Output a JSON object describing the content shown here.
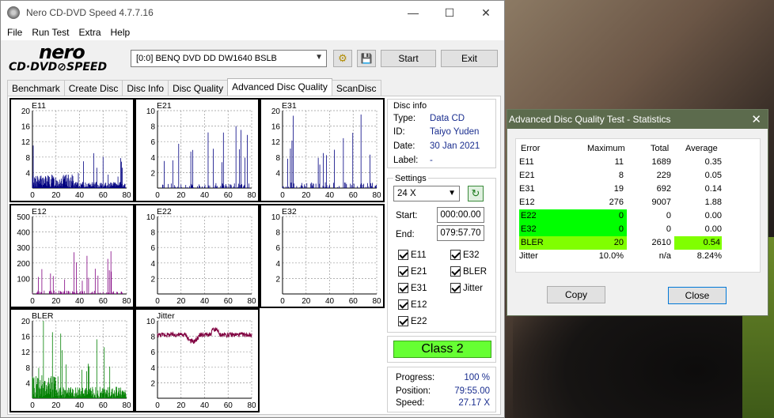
{
  "window": {
    "title": "Nero CD-DVD Speed 4.7.7.16",
    "menu": [
      "File",
      "Run Test",
      "Extra",
      "Help"
    ]
  },
  "logo": {
    "line1": "nero",
    "line2": "CD·DVD⊘SPEED"
  },
  "toolbar": {
    "drive": "[0:0]   BENQ DVD DD DW1640 BSLB",
    "start_label": "Start",
    "exit_label": "Exit"
  },
  "tabs": [
    "Benchmark",
    "Create Disc",
    "Disc Info",
    "Disc Quality",
    "Advanced Disc Quality",
    "ScanDisc"
  ],
  "active_tab": "Advanced Disc Quality",
  "disc_info": {
    "heading": "Disc info",
    "type_label": "Type:",
    "type": "Data CD",
    "id_label": "ID:",
    "id": "Taiyo Yuden",
    "date_label": "Date:",
    "date": "30 Jan 2021",
    "label_label": "Label:",
    "label": "-"
  },
  "settings": {
    "heading": "Settings",
    "speed": "24 X",
    "start_label": "Start:",
    "start": "000:00.00",
    "end_label": "End:",
    "end": "079:57.70",
    "checks_left": [
      "E11",
      "E21",
      "E31",
      "E12",
      "E22"
    ],
    "checks_right": [
      "E32",
      "BLER",
      "Jitter"
    ]
  },
  "class_label": "Class 2",
  "progress": {
    "progress_label": "Progress:",
    "progress": "100 %",
    "position_label": "Position:",
    "position": "79:55.00",
    "speed_label": "Speed:",
    "speed": "27.17 X"
  },
  "colors": {
    "bar": "#000080",
    "bler": "#008000",
    "jitter": "#800040",
    "class_bg": "#66ff33",
    "highlight": "#00ff00",
    "bler_highlight": "#80ff00"
  },
  "chart_data": [
    {
      "type": "bar",
      "title": "E11",
      "yticks": [
        20,
        16,
        12,
        8,
        4
      ],
      "xticks": [
        0,
        20,
        40,
        60,
        80
      ],
      "ylim": [
        0,
        20
      ],
      "xlim": [
        0,
        80
      ],
      "max": 11,
      "color": "#000080"
    },
    {
      "type": "bar",
      "title": "E21",
      "yticks": [
        10,
        8,
        6,
        4,
        2
      ],
      "xticks": [
        0,
        20,
        40,
        60,
        80
      ],
      "ylim": [
        0,
        10
      ],
      "xlim": [
        0,
        80
      ],
      "max": 8,
      "color": "#000080"
    },
    {
      "type": "bar",
      "title": "E31",
      "yticks": [
        20,
        16,
        12,
        8,
        4
      ],
      "xticks": [
        0,
        20,
        40,
        60,
        80
      ],
      "ylim": [
        0,
        20
      ],
      "xlim": [
        0,
        80
      ],
      "max": 19,
      "color": "#000080"
    },
    {
      "type": "bar",
      "title": "E12",
      "yticks": [
        500,
        400,
        300,
        200,
        100
      ],
      "xticks": [
        0,
        20,
        40,
        60,
        80
      ],
      "ylim": [
        0,
        500
      ],
      "xlim": [
        0,
        80
      ],
      "max": 276,
      "color": "#800080"
    },
    {
      "type": "bar",
      "title": "E22",
      "yticks": [
        10,
        8,
        6,
        4,
        2
      ],
      "xticks": [
        0,
        20,
        40,
        60,
        80
      ],
      "ylim": [
        0,
        10
      ],
      "xlim": [
        0,
        80
      ],
      "max": 0,
      "color": "#000080"
    },
    {
      "type": "bar",
      "title": "E32",
      "yticks": [
        10,
        8,
        6,
        4,
        2
      ],
      "xticks": [
        0,
        20,
        40,
        60,
        80
      ],
      "ylim": [
        0,
        10
      ],
      "xlim": [
        0,
        80
      ],
      "max": 0,
      "color": "#000080"
    },
    {
      "type": "bar",
      "title": "BLER",
      "yticks": [
        20,
        16,
        12,
        8,
        4
      ],
      "xticks": [
        0,
        20,
        40,
        60,
        80
      ],
      "ylim": [
        0,
        20
      ],
      "xlim": [
        0,
        80
      ],
      "max": 20,
      "color": "#008000"
    },
    {
      "type": "line",
      "title": "Jitter",
      "yticks": [
        10,
        8,
        6,
        4,
        2
      ],
      "xticks": [
        0,
        20,
        40,
        60,
        80
      ],
      "ylim": [
        0,
        10
      ],
      "xlim": [
        0,
        80
      ],
      "level": 8.2,
      "color": "#800040"
    }
  ],
  "stats_dialog": {
    "title": "Advanced Disc Quality Test - Statistics",
    "headers": [
      "Error",
      "Maximum",
      "Total",
      "Average"
    ],
    "rows": [
      {
        "name": "E11",
        "max": "11",
        "total": "1689",
        "avg": "0.35"
      },
      {
        "name": "E21",
        "max": "8",
        "total": "229",
        "avg": "0.05"
      },
      {
        "name": "E31",
        "max": "19",
        "total": "692",
        "avg": "0.14"
      },
      {
        "name": "E12",
        "max": "276",
        "total": "9007",
        "avg": "1.88"
      },
      {
        "name": "E22",
        "max": "0",
        "total": "0",
        "avg": "0.00"
      },
      {
        "name": "E32",
        "max": "0",
        "total": "0",
        "avg": "0.00"
      },
      {
        "name": "BLER",
        "max": "20",
        "total": "2610",
        "avg": "0.54"
      },
      {
        "name": "Jitter",
        "max": "10.0%",
        "total": "n/a",
        "avg": "8.24%"
      }
    ],
    "copy_label": "Copy",
    "close_label": "Close"
  }
}
